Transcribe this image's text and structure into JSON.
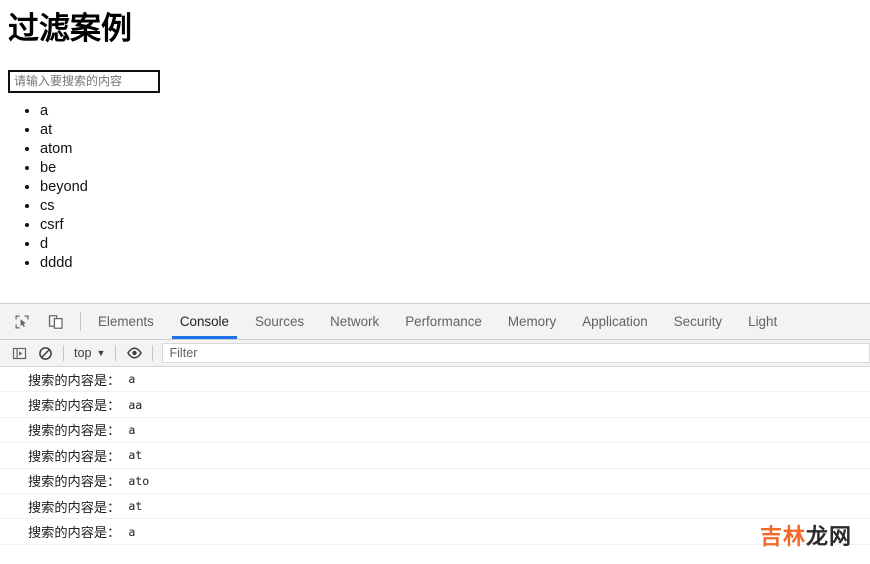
{
  "page": {
    "title": "过滤案例",
    "search": {
      "placeholder": "请输入要搜索的内容",
      "value": ""
    },
    "list_items": [
      {
        "label": "a"
      },
      {
        "label": "at"
      },
      {
        "label": "atom"
      },
      {
        "label": "be"
      },
      {
        "label": "beyond"
      },
      {
        "label": "cs"
      },
      {
        "label": "csrf"
      },
      {
        "label": "d"
      },
      {
        "label": "dddd"
      }
    ]
  },
  "devtools": {
    "left_icons": [
      {
        "name": "inspect-element-icon",
        "title": "Inspect"
      },
      {
        "name": "device-toolbar-icon",
        "title": "Toggle device toolbar"
      }
    ],
    "tabs": [
      {
        "label": "Elements",
        "active": false
      },
      {
        "label": "Console",
        "active": true
      },
      {
        "label": "Sources",
        "active": false
      },
      {
        "label": "Network",
        "active": false
      },
      {
        "label": "Performance",
        "active": false
      },
      {
        "label": "Memory",
        "active": false
      },
      {
        "label": "Application",
        "active": false
      },
      {
        "label": "Security",
        "active": false
      },
      {
        "label": "Light",
        "active": false
      }
    ],
    "active_tab": "Console",
    "accent_color": "#1a73e8",
    "console_toolbar": {
      "sidebar_toggle_icon": "console-sidebar-icon",
      "clear_icon": "clear-console-icon",
      "context_label": "top",
      "context_caret": "▼",
      "eye_icon": "live-expression-icon",
      "filter_placeholder": "Filter",
      "filter_value": ""
    },
    "console_messages": [
      {
        "label": "搜索的内容是：",
        "value": "a"
      },
      {
        "label": "搜索的内容是：",
        "value": "aa"
      },
      {
        "label": "搜索的内容是：",
        "value": "a"
      },
      {
        "label": "搜索的内容是：",
        "value": "at"
      },
      {
        "label": "搜索的内容是：",
        "value": "ato"
      },
      {
        "label": "搜索的内容是：",
        "value": "at"
      },
      {
        "label": "搜索的内容是：",
        "value": "a"
      }
    ]
  },
  "watermark": {
    "part1": "吉林",
    "part2": "龙网",
    "color1": "#f2682a",
    "color2": "#2b2b2b"
  }
}
